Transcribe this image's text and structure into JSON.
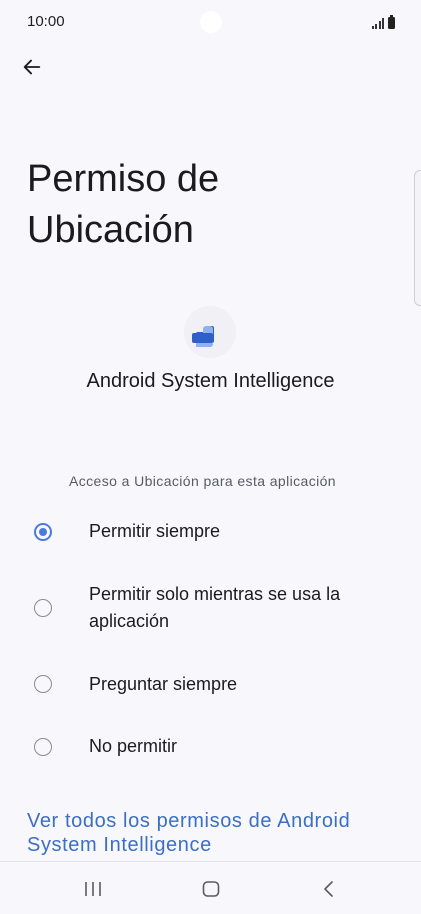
{
  "status_bar": {
    "time": "10:00"
  },
  "header": {
    "back_icon": "arrow-left-icon"
  },
  "page": {
    "title": "Permiso de Ubicación"
  },
  "app": {
    "icon": "android-system-intelligence-icon",
    "name": "Android System Intelligence"
  },
  "permission": {
    "section_label": "Acceso a Ubicación para esta aplicación",
    "selected": "Permitir siempre",
    "options": [
      {
        "label": "Permitir siempre",
        "checked": true
      },
      {
        "label": "Permitir solo mientras se usa la aplicación",
        "checked": false
      },
      {
        "label": "Preguntar siempre",
        "checked": false
      },
      {
        "label": "No permitir",
        "checked": false
      }
    ]
  },
  "link": {
    "text": "Ver todos los permisos de Android System Intelligence"
  },
  "nav_bar": {
    "recents_icon": "recents-icon",
    "home_icon": "home-icon",
    "back_icon": "back-chevron-icon"
  },
  "colors": {
    "accent": "#4a7ae0",
    "link": "#3b6fc4",
    "background": "#f7f7fc"
  }
}
